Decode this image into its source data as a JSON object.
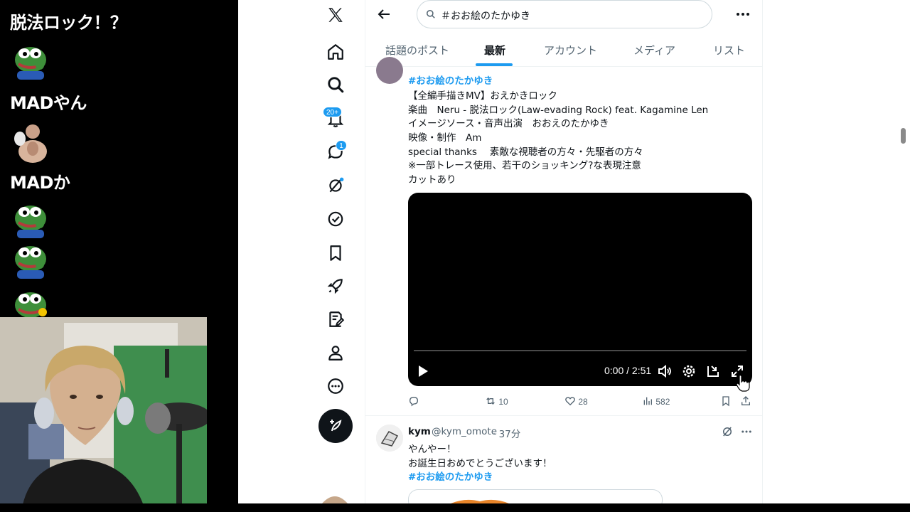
{
  "chat": {
    "messages": [
      {
        "type": "text",
        "text": "脱法ロック！？"
      },
      {
        "type": "emote",
        "icon": "frog-emote-icon"
      },
      {
        "type": "text",
        "text": "MADやん"
      },
      {
        "type": "emote",
        "icon": "person-emote-icon"
      },
      {
        "type": "text",
        "text": "MADか"
      },
      {
        "type": "emote",
        "icon": "frog-emote-icon"
      },
      {
        "type": "emote",
        "icon": "frog-emote-icon"
      },
      {
        "type": "emote",
        "icon": "frog-emote-icon"
      }
    ]
  },
  "nav": {
    "notifications_badge": "20+",
    "messages_badge": "1"
  },
  "search": {
    "query": "＃おお絵のたかゆき"
  },
  "tabs": [
    {
      "label": "話題のポスト",
      "active": false
    },
    {
      "label": "最新",
      "active": true
    },
    {
      "label": "アカウント",
      "active": false
    },
    {
      "label": "メディア",
      "active": false
    },
    {
      "label": "リスト",
      "active": false
    }
  ],
  "tweet1": {
    "hashtag": "#おお絵のたかゆき",
    "lines": [
      "【全編手描きMV】おえかきロック",
      "楽曲　Neru - 脱法ロック(Law-evading Rock) feat. Kagamine Len",
      "イメージソース・音声出演　おおえのたかゆき",
      "映像・制作　Am",
      "special thanks　 素敵な視聴者の方々・先駆者の方々",
      "※一部トレース使用、若干のショッキング?な表現注意",
      "カットあり"
    ],
    "video_time": "0:00 / 2:51",
    "video_progress": 0,
    "retweets": "10",
    "likes": "28",
    "views": "582"
  },
  "tweet2": {
    "name": "kym",
    "handle": "@kym_omote",
    "time": "· 37分",
    "lines": [
      "やんやー！",
      "お誕生日おめでとうございます！"
    ],
    "hashtag": "#おお絵のたかゆき"
  },
  "colors": {
    "accent": "#1d9bf0",
    "text": "#0f1419",
    "muted": "#536471"
  }
}
